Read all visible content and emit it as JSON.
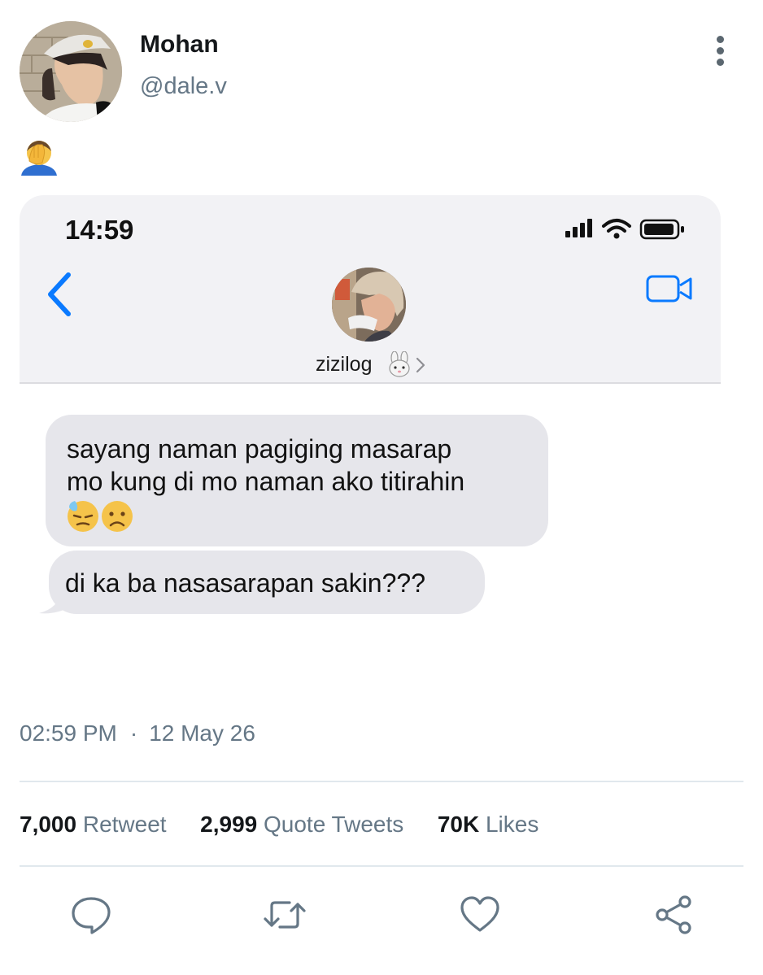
{
  "tweet": {
    "display_name": "Mohan",
    "handle": "@dale.v",
    "body_emoji_icon": "man-facepalming-icon"
  },
  "screenshot": {
    "status_bar": {
      "time": "14:59"
    },
    "contact": {
      "name": "zizilog"
    },
    "messages": [
      {
        "lines": [
          "sayang naman pagiging masarap",
          "mo kung di mo naman ako titirahin"
        ],
        "emojis": [
          "downcast-face-with-sweat-icon",
          "frowning-face-icon"
        ]
      },
      {
        "lines": [
          "di ka ba nasasarapan sakin???"
        ],
        "emojis": []
      }
    ]
  },
  "meta": {
    "time": "02:59 PM",
    "separator": "·",
    "date": "12 May 26"
  },
  "stats": {
    "retweets": {
      "count": "7,000",
      "label": "Retweet"
    },
    "quotes": {
      "count": "2,999",
      "label": "Quote Tweets"
    },
    "likes": {
      "count": "70K",
      "label": "Likes"
    }
  },
  "actions": [
    "reply-icon",
    "retweet-icon",
    "like-icon",
    "share-icon"
  ],
  "colors": {
    "ios_blue": "#0a7aff",
    "bubble_gray": "#e6e6eb",
    "muted_text": "#657786",
    "action_icon": "#657786"
  }
}
